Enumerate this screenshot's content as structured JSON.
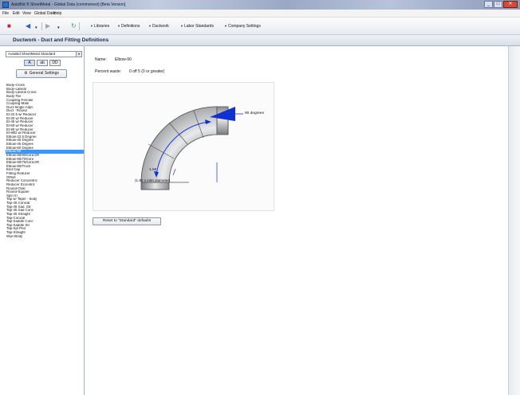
{
  "window": {
    "title": "AutoBid ® SheetMetal - Global Data (commonest) [Beta Version]",
    "buttons": {
      "minimize": "_",
      "maximize": "□",
      "close": "✕"
    }
  },
  "menubar": {
    "items": [
      "File",
      "Edit",
      "View",
      "Global Data",
      "Help"
    ]
  },
  "toolbar": {
    "items": [
      "Libraries",
      "Definitions",
      "Ductwork",
      "Labor Standards",
      "Company Settings"
    ]
  },
  "header": {
    "title": "Ductwork - Duct and Fitting Definitions"
  },
  "sidebar": {
    "standard_select": "AutoBid SheetMetal Standard",
    "view_buttons": [
      "A",
      "ab",
      "DD"
    ],
    "general_settings": "General Settings",
    "items": [
      "Body-Cross",
      "Body-Lateral",
      "Body-Lateral Cross",
      "Body-Tee",
      "Coupling-Female",
      "Coupling-Male",
      "Duct-Single Adpt.",
      "Duct - Round",
      "El-22.5 w/ Reducer",
      "El-30 w/ Reducer",
      "El-45 w/ Reducer",
      "El-60 w/ Reducer",
      "El-90 w/ Reducer",
      "El-90D w/ Reducer",
      "Elbow-22.5 Degree",
      "Elbow-30 Degree",
      "Elbow-45 Degree",
      "Elbow-60 Degree",
      "Elbow-90",
      "Elbow-90/90Gore/2R",
      "Elbow-90/70Gore",
      "Elbow-90/75Gore/2R",
      "Elbow-90/Truck",
      "End Cap",
      "Fitting Reducer",
      "Offset",
      "Reducer Concentric",
      "Reducer Eccentric",
      "Round-Oval",
      "Round-Square",
      "Spin In",
      "Tap w/ Taper - body",
      "Tap-45 Conical",
      "Tap-45 Sad. Str.",
      "Tap-45 Sad Conc",
      "Tap-45 Straight",
      "Tap-Conical",
      "Tap-Saddle Conc",
      "Tap-Saddle Str",
      "Tap-Spl Pnd",
      "Tap-Straight",
      "Wye-Body"
    ],
    "selected_index": 18
  },
  "main": {
    "name_label": "Name:",
    "name_value": "Elbow-90",
    "percent_label": "Percent waste:",
    "percent_value": "0 off  5  (0 or greater)",
    "diagram": {
      "angle_label": "90 degrees",
      "radius_label": "1.50",
      "radius_note": "(1.50 x inlet diameter)"
    },
    "reset_button": "Reset to \"Standard\" defaults"
  },
  "colors": {
    "accent": "#3399ff",
    "arrow": "#1030d0",
    "elbow_metal": "#b7b9bc"
  }
}
